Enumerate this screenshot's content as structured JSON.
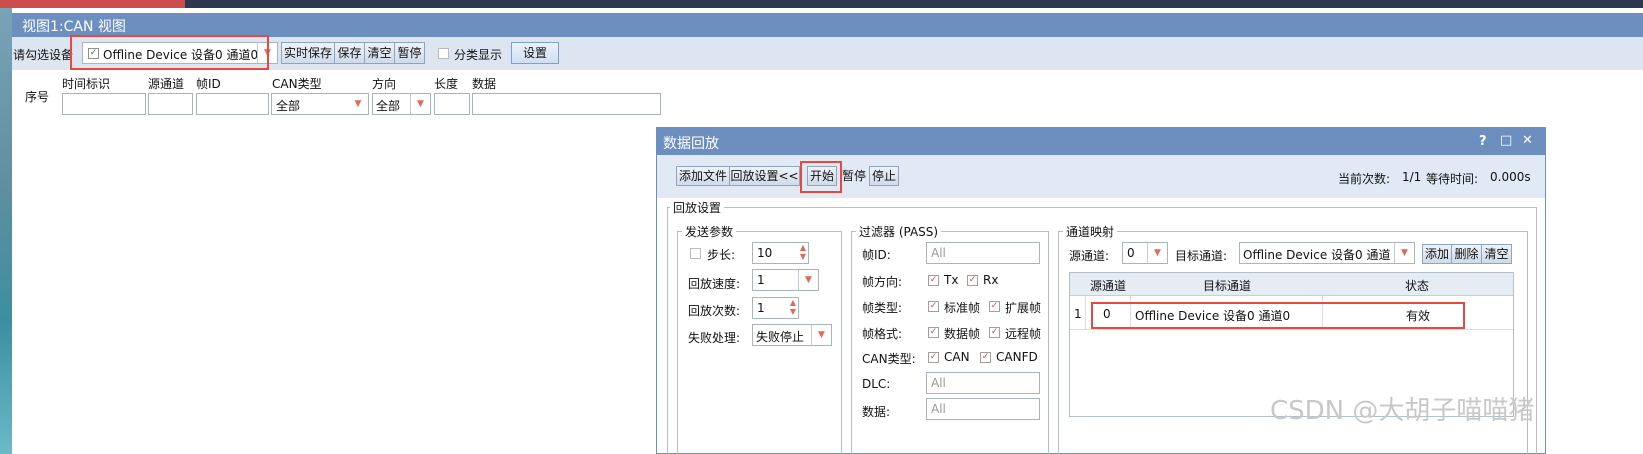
{
  "main": {
    "title": "视图1:CAN 视图",
    "toolbar": {
      "select_device_label": "请勾选设备",
      "device_combo": "Offline Device 设备0 通道0",
      "buttons": [
        "实时保存",
        "保存",
        "清空",
        "暂停"
      ],
      "classify_label": "分类显示",
      "settings_button": "设置"
    },
    "filter_headers": {
      "seq": "序号",
      "timestamp": "时间标识",
      "source_channel": "源通道",
      "frame_id": "帧ID",
      "can_type": "CAN类型",
      "direction": "方向",
      "length": "长度",
      "data": "数据"
    },
    "filter_values": {
      "can_type": "全部",
      "direction": "全部"
    }
  },
  "dialog": {
    "title": "数据回放",
    "title_icons": [
      "?",
      "□",
      "✕"
    ],
    "toolbar": {
      "add_file": "添加文件",
      "replay_settings": "回放设置<<",
      "start": "开始",
      "pause": "暂停",
      "stop": "停止",
      "current_count_label": "当前次数:",
      "current_count_value": "1/1",
      "wait_time_label": "等待时间:",
      "wait_time_value": "0.000s"
    },
    "replay_settings_title": "回放设置",
    "send_params": {
      "title": "发送参数",
      "step_label": "步长:",
      "step_value": "10",
      "speed_label": "回放速度:",
      "speed_value": "1",
      "count_label": "回放次数:",
      "count_value": "1",
      "fail_label": "失败处理:",
      "fail_value": "失败停止"
    },
    "filter": {
      "title": "过滤器 (PASS)",
      "frame_id_label": "帧ID:",
      "frame_id_placeholder": "All",
      "direction_label": "帧方向:",
      "tx": "Tx",
      "rx": "Rx",
      "frame_type_label": "帧类型:",
      "standard": "标准帧",
      "extended": "扩展帧",
      "frame_format_label": "帧格式:",
      "data_frame": "数据帧",
      "remote_frame": "远程帧",
      "can_type_label": "CAN类型:",
      "can": "CAN",
      "canfd": "CANFD",
      "dlc_label": "DLC:",
      "dlc_placeholder": "All",
      "data_label": "数据:",
      "data_placeholder": "All"
    },
    "channel_map": {
      "title": "通道映射",
      "source_label": "源通道:",
      "source_value": "0",
      "target_label": "目标通道:",
      "target_value": "Offline Device 设备0 通道0",
      "add": "添加",
      "delete": "删除",
      "clear": "清空",
      "columns": [
        "源通道",
        "目标通道",
        "状态"
      ],
      "rows": [
        {
          "index": "1",
          "source": "0",
          "target": "Offline Device 设备0 通道0",
          "status": "有效"
        }
      ]
    }
  },
  "watermark": "CSDN @大胡子喵喵猪",
  "colors": {
    "title_bar": "#6c8fbf",
    "toolbar_bg": "#dde6f0",
    "highlight": "#e8483f",
    "checkbox_red": "#e04a4a"
  }
}
